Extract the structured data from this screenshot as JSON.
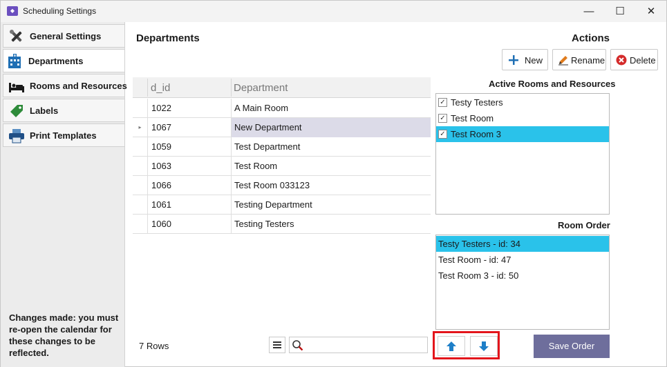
{
  "window": {
    "app_icon": "app-icon",
    "title": "Scheduling Settings",
    "controls": {
      "minimize": "—",
      "maximize": "☐",
      "close": "✕"
    }
  },
  "sidebar": {
    "items": [
      {
        "label": "General Settings",
        "icon": "tools-icon"
      },
      {
        "label": "Departments",
        "icon": "building-icon"
      },
      {
        "label": "Rooms and Resources",
        "icon": "bed-icon"
      },
      {
        "label": "Labels",
        "icon": "tag-icon"
      },
      {
        "label": "Print Templates",
        "icon": "printer-icon"
      }
    ],
    "active_index": 1,
    "note": "Changes made: you must re-open the calendar for these changes to be reflected."
  },
  "main": {
    "title": "Departments",
    "actions_title": "Actions",
    "actions": {
      "new_label": "New",
      "rename_label": "Rename",
      "delete_label": "Delete"
    },
    "grid": {
      "columns": [
        "d_id",
        "Department"
      ],
      "rows": [
        {
          "id": "1022",
          "department": "A Main Room"
        },
        {
          "id": "1067",
          "department": "New Department",
          "indicator": "▸"
        },
        {
          "id": "1059",
          "department": "Test Department"
        },
        {
          "id": "1063",
          "department": "Test Room"
        },
        {
          "id": "1066",
          "department": "Test Room 033123"
        },
        {
          "id": "1061",
          "department": "Testing Department"
        },
        {
          "id": "1060",
          "department": "Testing Testers"
        }
      ],
      "selected_index": 1,
      "row_count": "7 Rows",
      "search_value": ""
    },
    "active_rooms": {
      "title": "Active Rooms and Resources",
      "items": [
        {
          "label": "Testy Testers",
          "checked": true
        },
        {
          "label": "Test Room",
          "checked": true
        },
        {
          "label": "Test Room 3",
          "checked": true
        }
      ],
      "check_glyph": "✓",
      "selected_index": 2
    },
    "room_order": {
      "title": "Room Order",
      "items": [
        "Testy Testers - id: 34",
        "Test Room - id: 47",
        "Test Room 3 - id: 50"
      ],
      "selected_index": 0
    },
    "save_order_label": "Save Order"
  },
  "colors": {
    "selection": "#2ac2ea",
    "grid_selection": "#dcdbe8",
    "save_button": "#6e6e9c",
    "arrow": "#1e7fc8",
    "highlight_border": "#e3141b"
  }
}
